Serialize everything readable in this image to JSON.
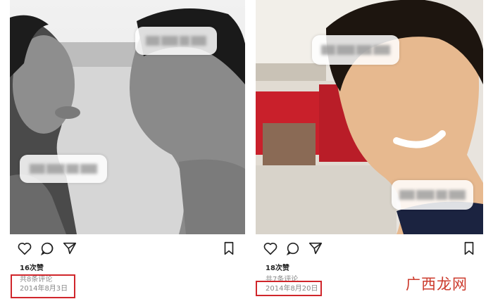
{
  "posts": [
    {
      "likes": "16次赞",
      "comments": "共8条评论",
      "date": "2014年8月3日",
      "icons": [
        "heart-icon",
        "comment-icon",
        "send-icon",
        "bookmark-icon"
      ],
      "tag_labels": [
        "blurred-tag",
        "blurred-tag"
      ]
    },
    {
      "likes": "18次赞",
      "comments": "共7条评论",
      "date": "2014年8月20日",
      "icons": [
        "heart-icon",
        "comment-icon",
        "send-icon",
        "bookmark-icon"
      ],
      "tag_labels": [
        "blurred-tag",
        "blurred-tag"
      ]
    }
  ],
  "watermark": {
    "text": "广西龙网",
    "color": "#cc3b2d"
  },
  "highlight_color": "#d0262b"
}
